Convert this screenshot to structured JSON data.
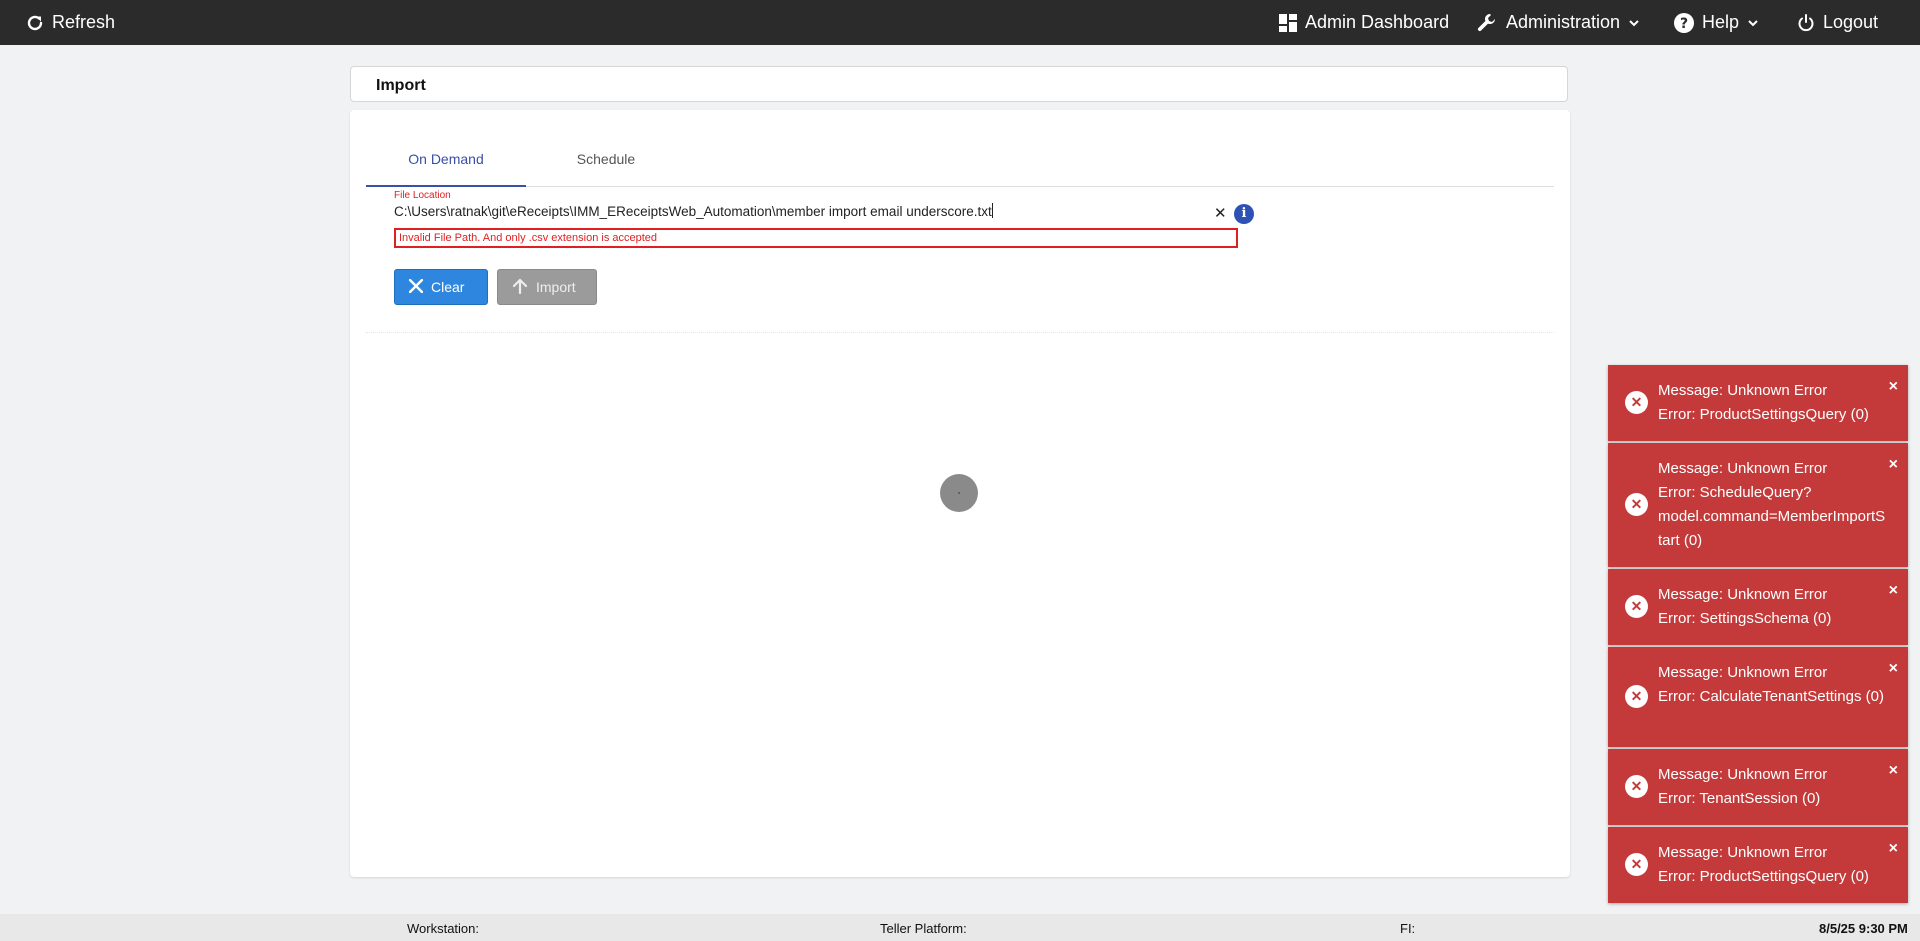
{
  "topbar": {
    "refresh": "Refresh",
    "admin_dashboard": "Admin Dashboard",
    "administration": "Administration",
    "help": "Help",
    "logout": "Logout"
  },
  "header": {
    "title": "Import"
  },
  "tabs": [
    {
      "label": "On Demand",
      "active": true
    },
    {
      "label": "Schedule",
      "active": false
    }
  ],
  "file_field": {
    "label": "File Location",
    "value": "C:\\Users\\ratnak\\git\\eReceipts\\IMM_EReceiptsWeb_Automation\\member import email underscore.txt",
    "error": "Invalid File Path. And only .csv extension is accepted"
  },
  "buttons": {
    "clear": "Clear",
    "import": "Import"
  },
  "toasts": [
    {
      "message": "Message: Unknown Error",
      "error": "Error: ProductSettingsQuery (0)"
    },
    {
      "message": "Message: Unknown Error",
      "error": "Error: ScheduleQuery?model.command=MemberImportStart (0)"
    },
    {
      "message": "Message: Unknown Error",
      "error": "Error: SettingsSchema (0)"
    },
    {
      "message": "Message: Unknown Error",
      "error": "Error: CalculateTenantSettings (0)"
    },
    {
      "message": "Message: Unknown Error",
      "error": "Error: TenantSession (0)"
    },
    {
      "message": "Message: Unknown Error",
      "error": "Error: ProductSettingsQuery (0)"
    }
  ],
  "footer": {
    "workstation": "Workstation:",
    "teller_platform": "Teller Platform:",
    "fi": "FI:",
    "datetime": "8/5/25 9:30 PM"
  },
  "colors": {
    "topbar": "#2b2b2b",
    "accent": "#3a4fa8",
    "error": "#e02020",
    "toast": "#c43a3a",
    "clear_button": "#2e86de"
  }
}
